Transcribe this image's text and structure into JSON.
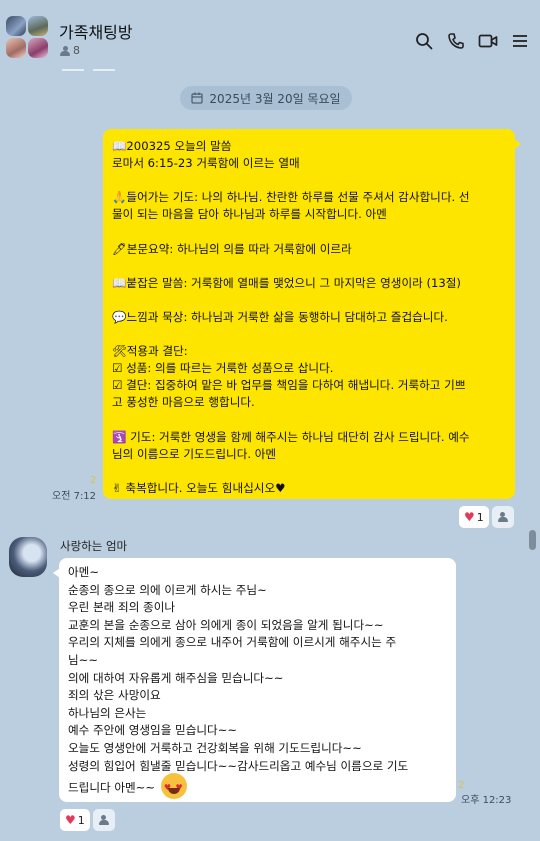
{
  "header": {
    "title": "가족채팅방",
    "member_count": "8",
    "icons": [
      "search-icon",
      "phone-icon",
      "video-icon",
      "menu-icon"
    ]
  },
  "date_divider": {
    "text": "2025년 3월 20일 목요일",
    "icon": "calendar-icon"
  },
  "my_message": {
    "lines": [
      "📖200325 오늘의 말씀",
      "로마서 6:15-23 거룩함에 이르는 열매",
      "",
      "🙏들어가는 기도: 나의 하나님. 찬란한 하루를 선물 주셔서 감사합니다. 선",
      "물이 되는 마음을 담아 하나님과 하루를 시작합니다. 아멘",
      "",
      "🖊본문요약: 하나님의 의를 따라 거룩함에 이르라",
      "",
      "📖붙잡은 말씀: 거룩함에 열매를 맺었으니 그 마지막은 영생이라 (13절)",
      "",
      "💬느낌과 묵상: 하나님과 거룩한 삶을 동행하니 담대하고 즐겁습니다.",
      "",
      "🛠적용과 결단:",
      "☑ 성품: 의를 따르는 거룩한 성품으로 삽니다.",
      "☑ 결단: 집중하여 맡은 바 업무를 책임을 다하여 해냅니다. 거룩하고 기쁘",
      "고 풍성한 마음으로 행합니다.",
      "",
      "🛐 기도: 거룩한 영생을 함께 해주시는 하나님 대단히 감사 드립니다. 예수",
      "님의 이름으로 기도드립니다. 아멘",
      "",
      "✌ 축복합니다. 오늘도 힘내십시오♥"
    ],
    "read_count": "2",
    "time": "오전 7:12",
    "reaction_count": "1"
  },
  "other_message": {
    "sender": "사랑하는 엄마",
    "lines": [
      "아멘~",
      "순종의 종으로 의에 이르게 하시는 주님~",
      "우린 본래  죄의 종이나",
      "교훈의 본을 순종으로 삼아 의에게 종이 되었음을 알게 됩니다~~",
      "우리의 지체를 의에게 종으로 내주어 거룩함에 이르시게 해주시는 주",
      "님~~",
      "의에 대하여 자유롭게 해주심을 믿습니다~~",
      "죄의 삯은 사망이요",
      "하나님의 은사는",
      "예수 주안에 영생임을 믿습니다~~",
      "오늘도 영생안에 거룩하고 건강회복을 위해 기도드립니다~~",
      "성령의 힘입어 힘낼줄 믿습니다~~감사드리옵고 예수님 이름으로 기도",
      "드립니다 아멘~~"
    ],
    "read_count": "2",
    "time": "오후 12:23",
    "reaction_count": "1"
  },
  "colors": {
    "background": "#bacee0",
    "my_bubble": "#fee500",
    "other_bubble": "#ffffff",
    "heart": "#e13a5a"
  }
}
